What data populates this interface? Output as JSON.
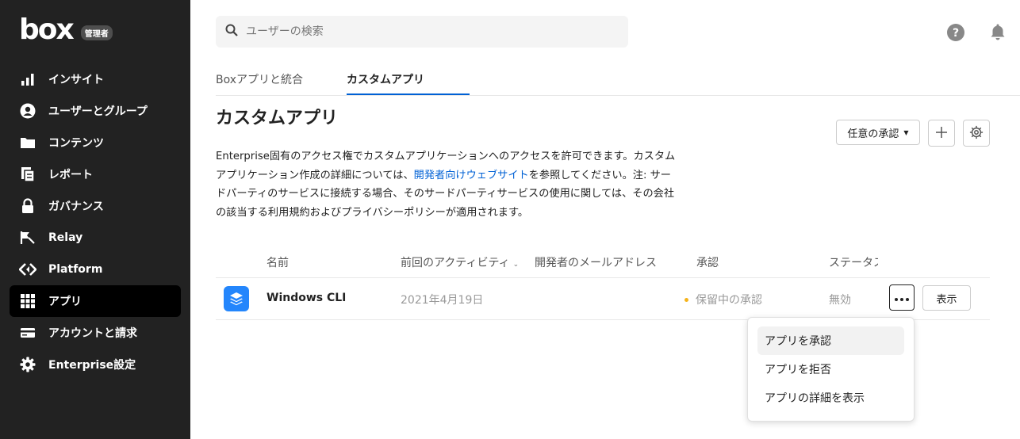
{
  "brand": {
    "logo": "box",
    "admin_badge": "管理者"
  },
  "sidebar": {
    "items": [
      {
        "label": "インサイト",
        "icon": "bar-chart-icon",
        "active": false
      },
      {
        "label": "ユーザーとグループ",
        "icon": "user-circle-icon",
        "active": false
      },
      {
        "label": "コンテンツ",
        "icon": "folder-icon",
        "active": false
      },
      {
        "label": "レポート",
        "icon": "report-icon",
        "active": false
      },
      {
        "label": "ガバナンス",
        "icon": "lock-icon",
        "active": false
      },
      {
        "label": "Relay",
        "icon": "relay-icon",
        "active": false
      },
      {
        "label": "Platform",
        "icon": "platform-icon",
        "active": false
      },
      {
        "label": "アプリ",
        "icon": "grid-icon",
        "active": true
      },
      {
        "label": "アカウントと請求",
        "icon": "credit-card-icon",
        "active": false
      },
      {
        "label": "Enterprise設定",
        "icon": "gear-icon",
        "active": false
      }
    ]
  },
  "search": {
    "placeholder": "ユーザーの検索"
  },
  "tabs": [
    {
      "label": "Boxアプリと統合",
      "active": false
    },
    {
      "label": "カスタムアプリ",
      "active": true
    }
  ],
  "page": {
    "title": "カスタムアプリ",
    "approval_dropdown": "任意の承認",
    "description_part1": "Enterprise固有のアクセス権でカスタムアプリケーションへのアクセスを許可できます。カスタムアプリケーション作成の詳細については、",
    "description_link": "開発者向けウェブサイト",
    "description_part2": "を参照してください。注: サードパーティのサービスに接続する場合、そのサードパーティサービスの使用に関しては、その会社の該当する利用規約およびプライバシーポリシーが適用されます。"
  },
  "table": {
    "headers": {
      "name": "名前",
      "activity": "前回のアクティビティ",
      "email": "開発者のメールアドレス",
      "approval": "承認",
      "status": "ステータス"
    },
    "rows": [
      {
        "name": "Windows CLI",
        "activity": "2021年4月19日",
        "email": "",
        "approval": "保留中の承認",
        "status": "無効",
        "view": "表示"
      }
    ]
  },
  "menu": {
    "items": [
      {
        "label": "アプリを承認"
      },
      {
        "label": "アプリを拒否"
      },
      {
        "label": "アプリの詳細を表示"
      }
    ]
  },
  "colors": {
    "sidebar_bg": "#222222",
    "accent": "#0061d5",
    "pending_dot": "#f5b31b",
    "app_icon": "#2486fc"
  }
}
